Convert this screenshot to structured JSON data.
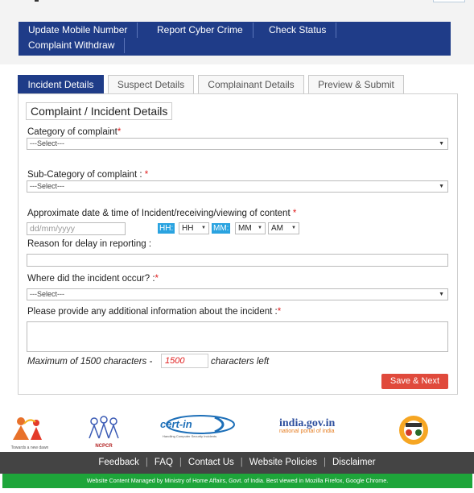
{
  "nav": {
    "update_mobile": "Update Mobile Number",
    "report_crime": "Report Cyber Crime",
    "check_status": "Check Status",
    "withdraw": "Complaint Withdraw"
  },
  "tabs": {
    "incident": "Incident Details",
    "suspect": "Suspect Details",
    "complainant": "Complainant Details",
    "preview": "Preview & Submit"
  },
  "form": {
    "legend": "Complaint / Incident Details",
    "category_label": "Category of complaint",
    "category_value": "---Select---",
    "subcategory_label": "Sub-Category of complaint : ",
    "subcategory_value": "---Select---",
    "date_label": "Approximate date & time of Incident/receiving/viewing of content ",
    "date_placeholder": "dd/mm/yyyy",
    "hh_label": "HH:",
    "hh_value": "HH",
    "mm_label": "MM:",
    "mm_value": "MM",
    "ampm_value": "AM",
    "reason_label": "Reason for delay in reporting :",
    "where_label": "Where did the incident occur? :",
    "where_value": "---Select---",
    "info_label": "Please provide any additional information about the incident :",
    "max_prefix": "Maximum of 1500 characters - ",
    "counter_value": "1500",
    "chars_left": "characters left",
    "required_mark": "*",
    "save_button": "Save & Next"
  },
  "logos": {
    "first_caption": "Towards a new dawn",
    "ncpcr": "NCPCR",
    "cert": "cert-in",
    "cert_tag": "Handling Computer Security Incidents",
    "india_gov": "india.gov.in",
    "india_sub": "national portal of india"
  },
  "footer": {
    "feedback": "Feedback",
    "faq": "FAQ",
    "contact": "Contact Us",
    "policies": "Website Policies",
    "disclaimer": "Disclaimer",
    "separator": "|",
    "managed": "Website Content Managed by Ministry of Home Affairs, Govt. of India. Best viewed in Mozilla Firefox, Google Chrome."
  },
  "colors": {
    "nav_bg": "#1f3c88",
    "save_bg": "#e04a3c",
    "time_label_bg": "#2aa3e0",
    "footer_bg": "#444444",
    "footer_bottom_bg": "#1ea53a"
  }
}
